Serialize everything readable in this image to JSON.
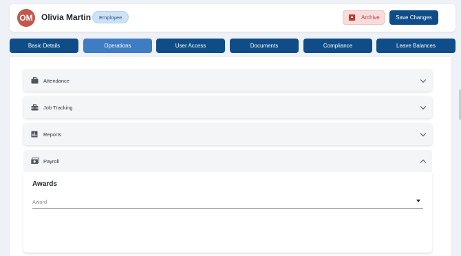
{
  "header": {
    "avatar_initials": "OM",
    "name": "Olivia Martin",
    "badge": "Employee",
    "archive_label": "Archive",
    "save_label": "Save Changes"
  },
  "tabs": [
    {
      "label": "Basic Details",
      "active": false
    },
    {
      "label": "Operations",
      "active": true
    },
    {
      "label": "User Access",
      "active": false
    },
    {
      "label": "Documents",
      "active": false
    },
    {
      "label": "Compliance",
      "active": false
    },
    {
      "label": "Leave Balances",
      "active": false
    }
  ],
  "sections": [
    {
      "label": "Attendance",
      "icon": "briefcase-icon",
      "expanded": false
    },
    {
      "label": "Job Tracking",
      "icon": "toolbox-icon",
      "expanded": false
    },
    {
      "label": "Reports",
      "icon": "bar-chart-icon",
      "expanded": false
    },
    {
      "label": "Payroll",
      "icon": "money-icon",
      "expanded": true
    }
  ],
  "payroll": {
    "awards_title": "Awards",
    "award_placeholder": "Award"
  },
  "colors": {
    "primary": "#0e4d88",
    "active_tab": "#3e7cc4",
    "avatar": "#c4574b",
    "archive": "#c0392b"
  }
}
